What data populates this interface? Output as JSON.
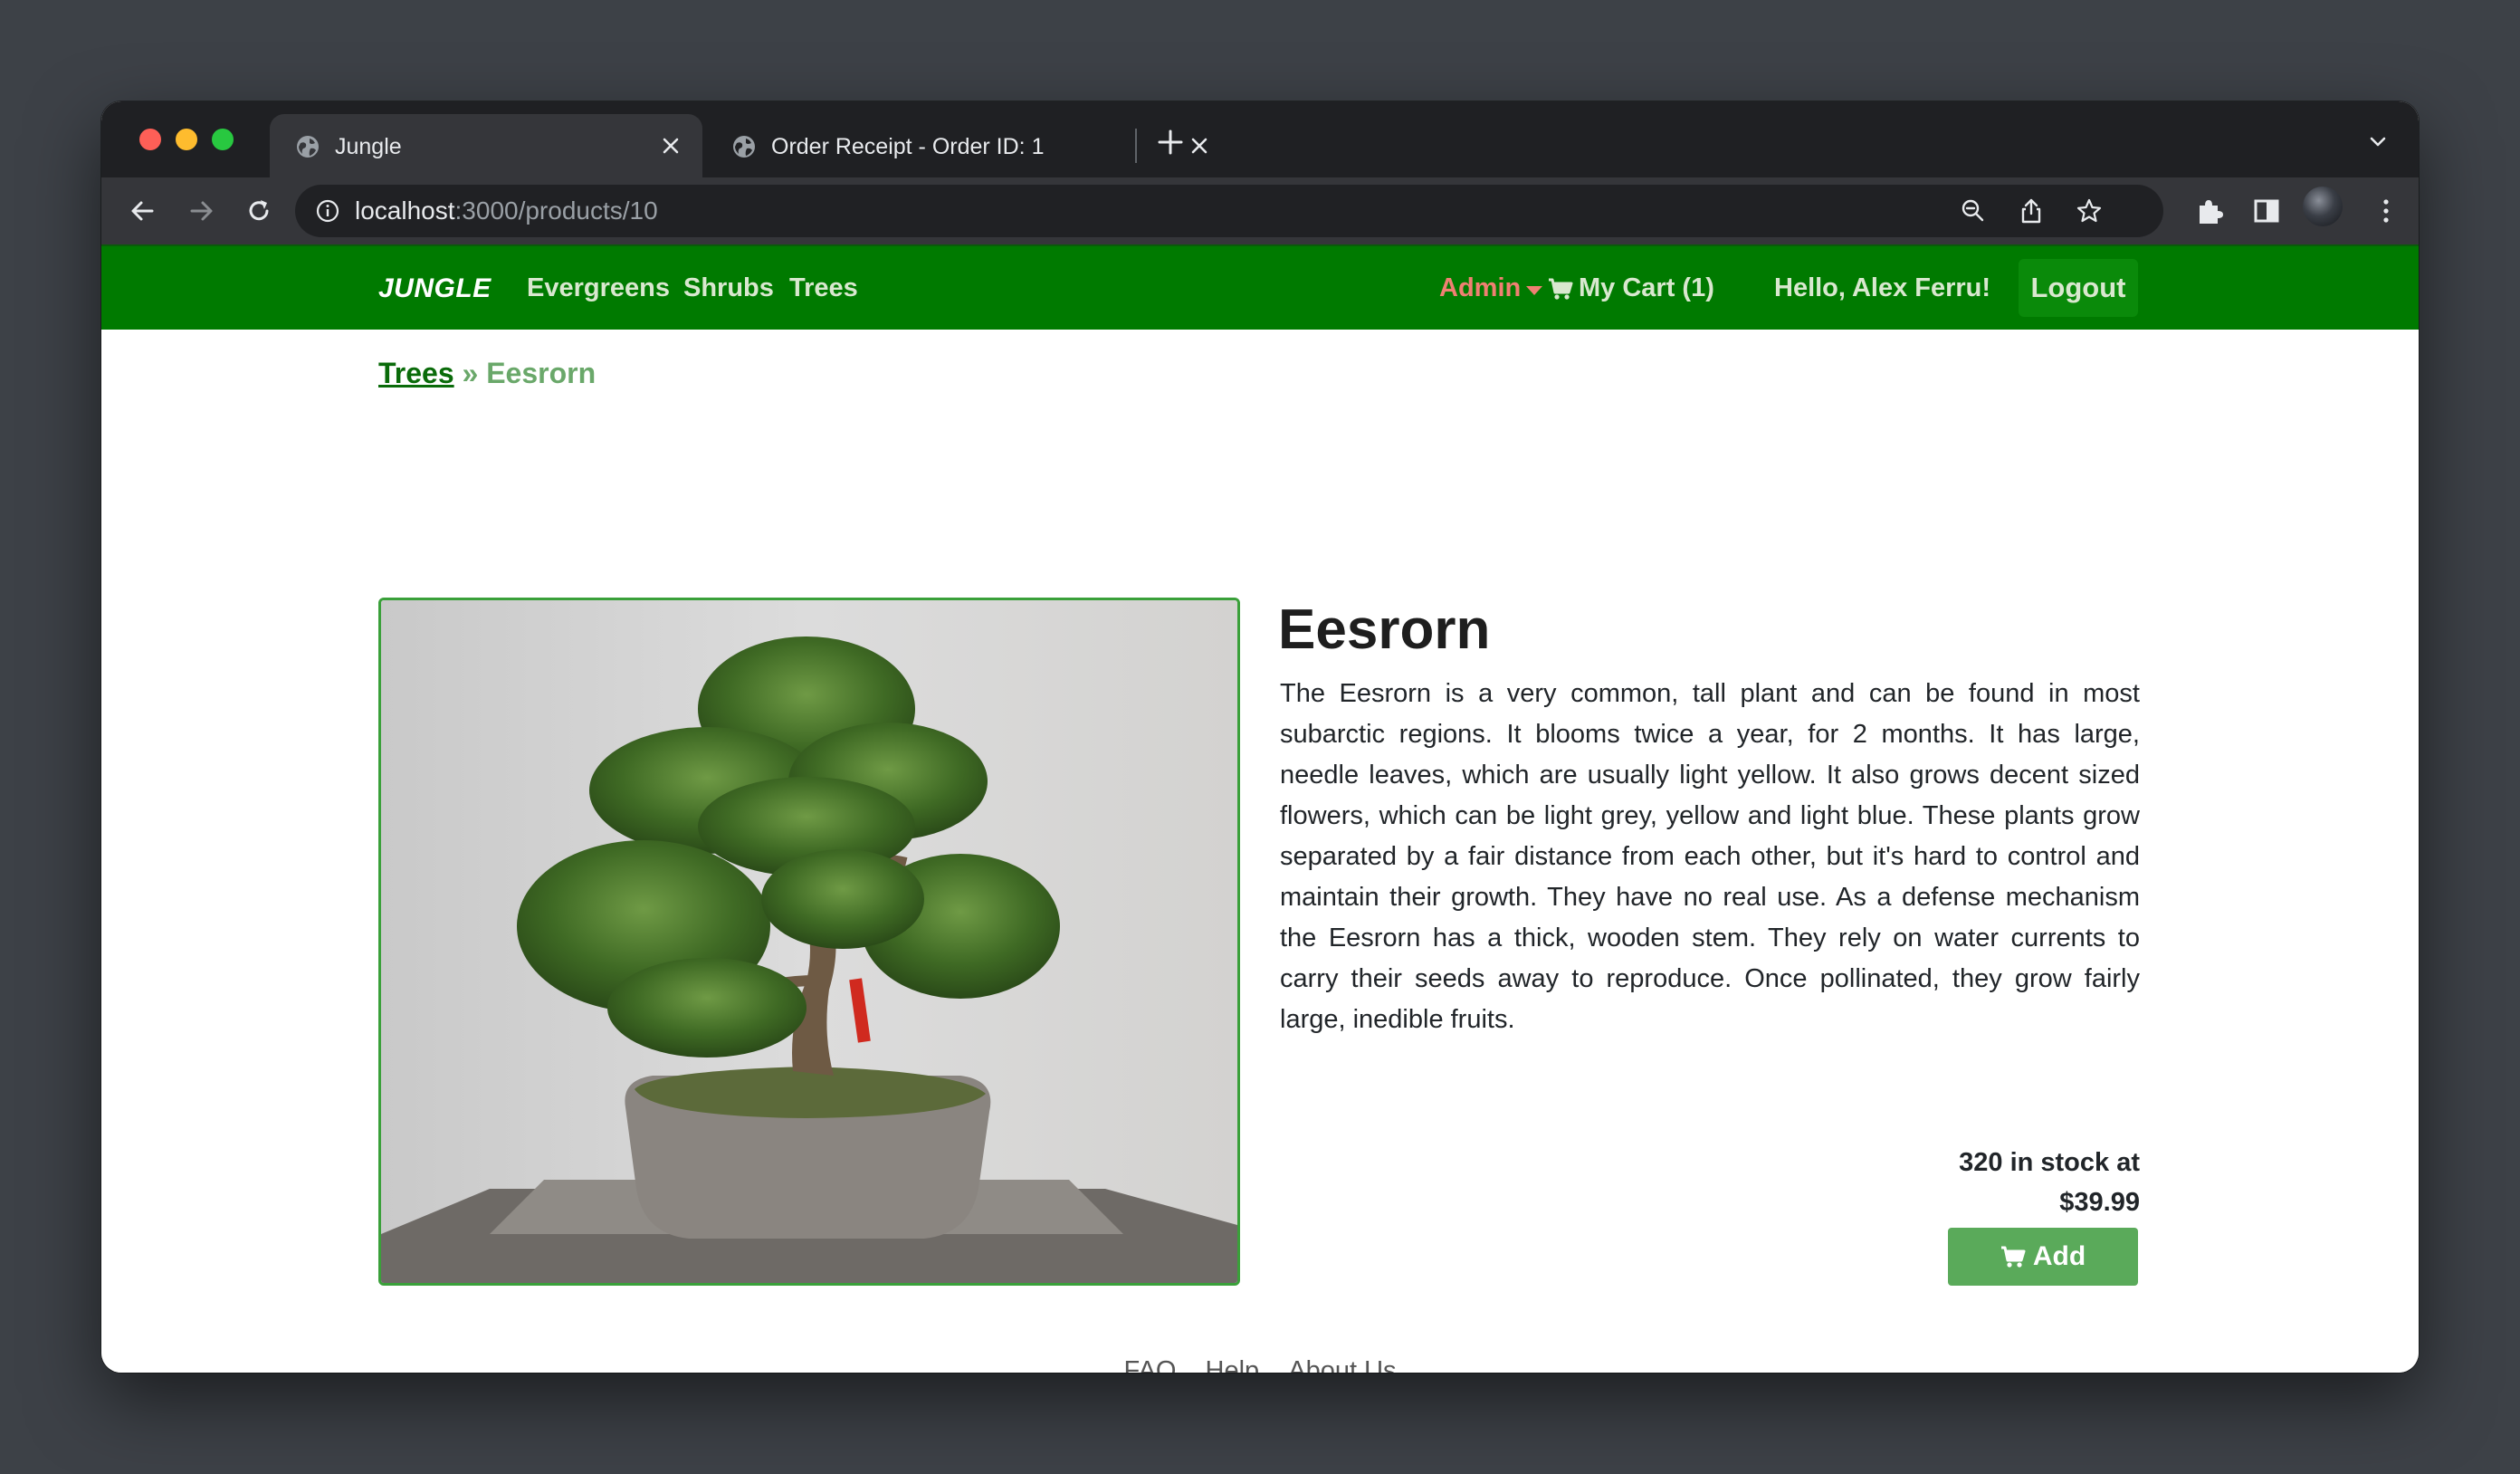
{
  "browser": {
    "tabs": [
      {
        "title": "Jungle",
        "active": true
      },
      {
        "title": "Order Receipt - Order ID: 1",
        "active": false
      }
    ],
    "url_host": "localhost",
    "url_rest": ":3000/products/10"
  },
  "navbar": {
    "brand": "JUNGLE",
    "links": [
      "Evergreens",
      "Shrubs",
      "Trees"
    ],
    "admin_label": "Admin",
    "cart_label": "My Cart (1)",
    "greeting": "Hello, Alex Ferru!",
    "logout_label": "Logout",
    "colors": {
      "bar": "#007a00",
      "admin": "#f08072"
    }
  },
  "breadcrumb": {
    "parent": "Trees",
    "separator": "»",
    "current": "Eesrorn"
  },
  "product": {
    "name": "Eesrorn",
    "description": "The Eesrorn is a very common, tall plant and can be found in most subarctic regions. It blooms twice a year, for 2 months. It has large, needle leaves, which are usually light yellow. It also grows decent sized flowers, which can be light grey, yellow and light blue. These plants grow separated by a fair distance from each other, but it's hard to control and maintain their growth. They have no real use. As a defense mechanism the Eesrorn has a thick, wooden stem. They rely on water currents to carry their seeds away to reproduce. Once pollinated, they grow fairly large, inedible fruits.",
    "stock_text": "320 in stock at",
    "price": "$39.99",
    "add_label": "Add",
    "image_icon": "bonsai-tree-photo"
  },
  "footer": {
    "links": [
      "FAQ",
      "Help",
      "About Us"
    ]
  }
}
